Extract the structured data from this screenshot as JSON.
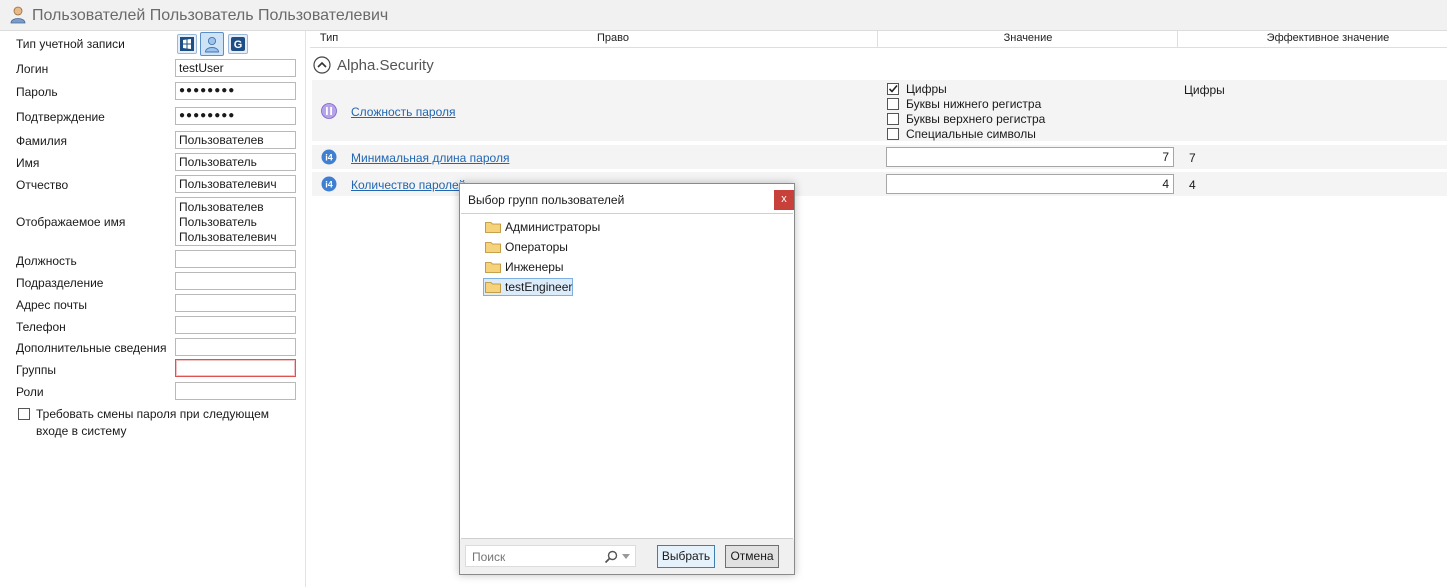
{
  "window": {
    "title": "Пользователей Пользователь Пользователевич"
  },
  "form": {
    "account_type_label": "Тип учетной записи",
    "login": {
      "label": "Логин",
      "value": "testUser"
    },
    "password": {
      "label": "Пароль",
      "value": "●●●●●●●●"
    },
    "confirm": {
      "label": "Подтверждение",
      "value": "●●●●●●●●"
    },
    "last_name": {
      "label": "Фамилия",
      "value": "Пользователев"
    },
    "first_name": {
      "label": "Имя",
      "value": "Пользователь"
    },
    "patronymic": {
      "label": "Отчество",
      "value": "Пользователевич"
    },
    "display_name": {
      "label": "Отображаемое имя",
      "lines": [
        "Пользователев",
        "Пользователь",
        "Пользователевич"
      ]
    },
    "position": {
      "label": "Должность",
      "value": ""
    },
    "department": {
      "label": "Подразделение",
      "value": ""
    },
    "email": {
      "label": "Адрес почты",
      "value": ""
    },
    "phone": {
      "label": "Телефон",
      "value": ""
    },
    "extra": {
      "label": "Дополнительные сведения",
      "value": ""
    },
    "groups": {
      "label": "Группы",
      "value": ""
    },
    "roles": {
      "label": "Роли",
      "value": ""
    },
    "require_change": {
      "line1": "Требовать смены пароля при следующем",
      "line2": "входе в систему",
      "checked": false
    }
  },
  "table": {
    "headers": {
      "type": "Тип",
      "right": "Право",
      "value": "Значение",
      "effective": "Эффективное значение"
    },
    "group_name": "Alpha.Security",
    "rows": [
      {
        "type_icon": "enum-icon",
        "name": "Сложность пароля",
        "options": [
          {
            "label": "Цифры",
            "checked": true
          },
          {
            "label": "Буквы нижнего регистра",
            "checked": false
          },
          {
            "label": "Буквы верхнего регистра",
            "checked": false
          },
          {
            "label": "Специальные символы",
            "checked": false
          }
        ],
        "effective": "Цифры"
      },
      {
        "type_icon": "i4-icon",
        "type_text": "i4",
        "name": "Минимальная длина пароля",
        "value": "7",
        "effective": "7"
      },
      {
        "type_icon": "i4-icon",
        "type_text": "i4",
        "name": "Количество паролей",
        "value": "4",
        "effective": "4"
      }
    ]
  },
  "dialog": {
    "title": "Выбор групп пользователей",
    "close": "x",
    "groups": [
      "Администраторы",
      "Операторы",
      "Инженеры",
      "testEngineer"
    ],
    "selected_index": 3,
    "search_placeholder": "Поиск",
    "ok_label": "Выбрать",
    "cancel_label": "Отмена"
  },
  "colors": {
    "link": "#2266b0",
    "error_border": "#e05252",
    "close_button": "#c7403a",
    "selection": "#dcebfa"
  }
}
